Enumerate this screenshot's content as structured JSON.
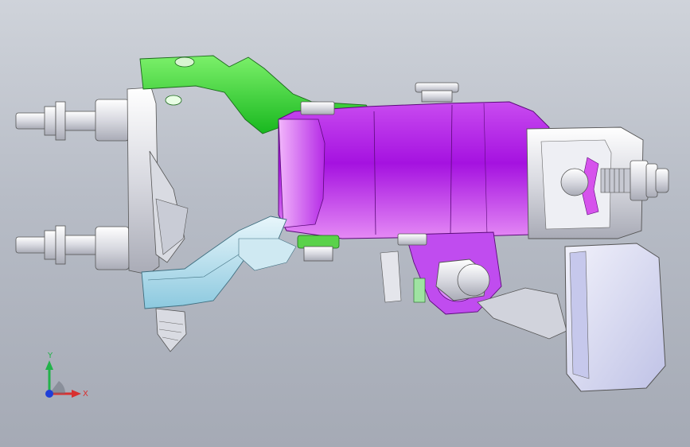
{
  "viewport": {
    "background_top": "#cfd3da",
    "background_bottom": "#a5aab5"
  },
  "model": {
    "part_colors": {
      "upper_bracket": "#2fd12f",
      "main_housing": "#b21fe6",
      "lower_bracket": "#9fd6e6",
      "mount_pad": "#d7d9f2",
      "fasteners": "#e4e4e8",
      "nut_accent": "#5ad24a"
    }
  },
  "triad": {
    "y_label": "Y",
    "x_label": "X",
    "y_color": "#22b24a",
    "x_color": "#d83030",
    "z_color": "#1f3fd8"
  }
}
